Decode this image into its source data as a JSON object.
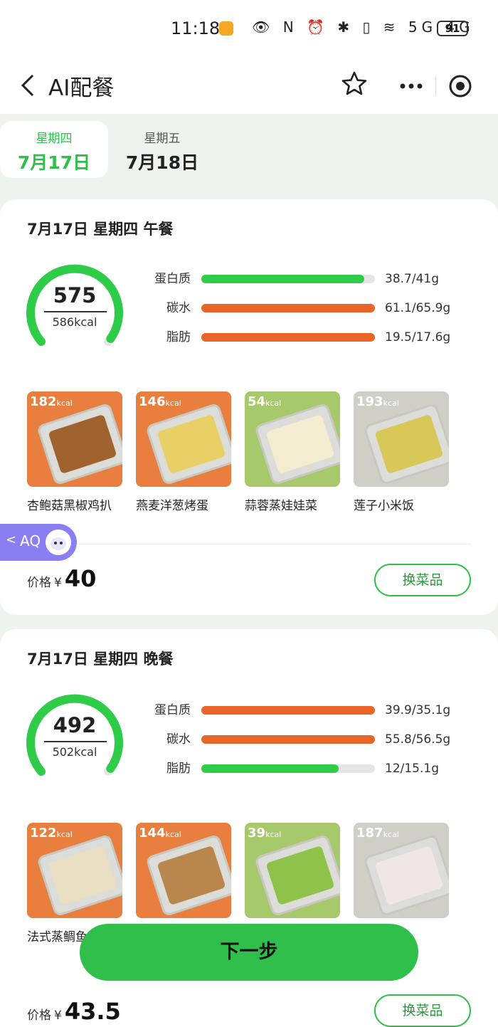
{
  "status_bar": {
    "time": "11:18",
    "icons_text": "👁 N ⏰ ✱ ▯ ≋ 5G 4G",
    "battery": "91"
  },
  "nav": {
    "title": "AI配餐",
    "back_icon": "chevron-left-icon",
    "star_icon": "star-icon",
    "more_icon": "more-icon",
    "target_icon": "target-icon"
  },
  "tabs": [
    {
      "weekday": "星期四",
      "date": "7月17日"
    },
    {
      "weekday": "星期五",
      "date": "7月18日"
    }
  ],
  "lunch": {
    "title": "7月17日 星期四 午餐",
    "kcal": "575",
    "target": "586kcal",
    "kcal_fraction": 0.98,
    "macros": [
      {
        "label": "蛋白质",
        "value": "38.7/41g",
        "fraction": 0.94,
        "color": "#2fcc4a"
      },
      {
        "label": "碳水",
        "value": "61.1/65.9g",
        "fraction": 1.0,
        "color": "#e8652a"
      },
      {
        "label": "脂肪",
        "value": "19.5/17.6g",
        "fraction": 1.0,
        "color": "#e8652a"
      }
    ],
    "dishes": [
      {
        "name": "杏鲍菇黑椒鸡扒",
        "kcal": "182",
        "unit": "kcal",
        "bg": "#e97f3e",
        "food": "#a0622e"
      },
      {
        "name": "燕麦洋葱烤蛋",
        "kcal": "146",
        "unit": "kcal",
        "bg": "#e97f3e",
        "food": "#e8d067"
      },
      {
        "name": "蒜蓉蒸娃娃菜",
        "kcal": "54",
        "unit": "kcal",
        "bg": "#a7c96b",
        "food": "#f3ecd0"
      },
      {
        "name": "莲子小米饭",
        "kcal": "193",
        "unit": "kcal",
        "bg": "#cfcfc7",
        "food": "#d8c85a"
      }
    ],
    "price_label": "价格",
    "currency": "¥",
    "price": "40",
    "swap_label": "换菜品"
  },
  "dinner": {
    "title": "7月17日 星期四 晚餐",
    "kcal": "492",
    "target": "502kcal",
    "kcal_fraction": 0.98,
    "macros": [
      {
        "label": "蛋白质",
        "value": "39.9/35.1g",
        "fraction": 1.0,
        "color": "#e8652a"
      },
      {
        "label": "碳水",
        "value": "55.8/56.5g",
        "fraction": 1.0,
        "color": "#e8652a"
      },
      {
        "label": "脂肪",
        "value": "12/15.1g",
        "fraction": 0.79,
        "color": "#2fcc4a"
      }
    ],
    "dishes": [
      {
        "name": "法式蒸鲷鱼",
        "kcal": "122",
        "unit": "kcal",
        "bg": "#e97f3e",
        "food": "#eadfc2"
      },
      {
        "name": "",
        "kcal": "144",
        "unit": "kcal",
        "bg": "#e97f3e",
        "food": "#b9874e"
      },
      {
        "name": "",
        "kcal": "39",
        "unit": "kcal",
        "bg": "#a7c96b",
        "food": "#8fc24a"
      },
      {
        "name": "",
        "kcal": "187",
        "unit": "kcal",
        "bg": "#cfcfc7",
        "food": "#efe7e4"
      }
    ],
    "price_label": "价格",
    "currency": "¥",
    "price": "43.5",
    "swap_label": "换菜品"
  },
  "assistant": {
    "label": "AQ"
  },
  "next_label": "下一步"
}
